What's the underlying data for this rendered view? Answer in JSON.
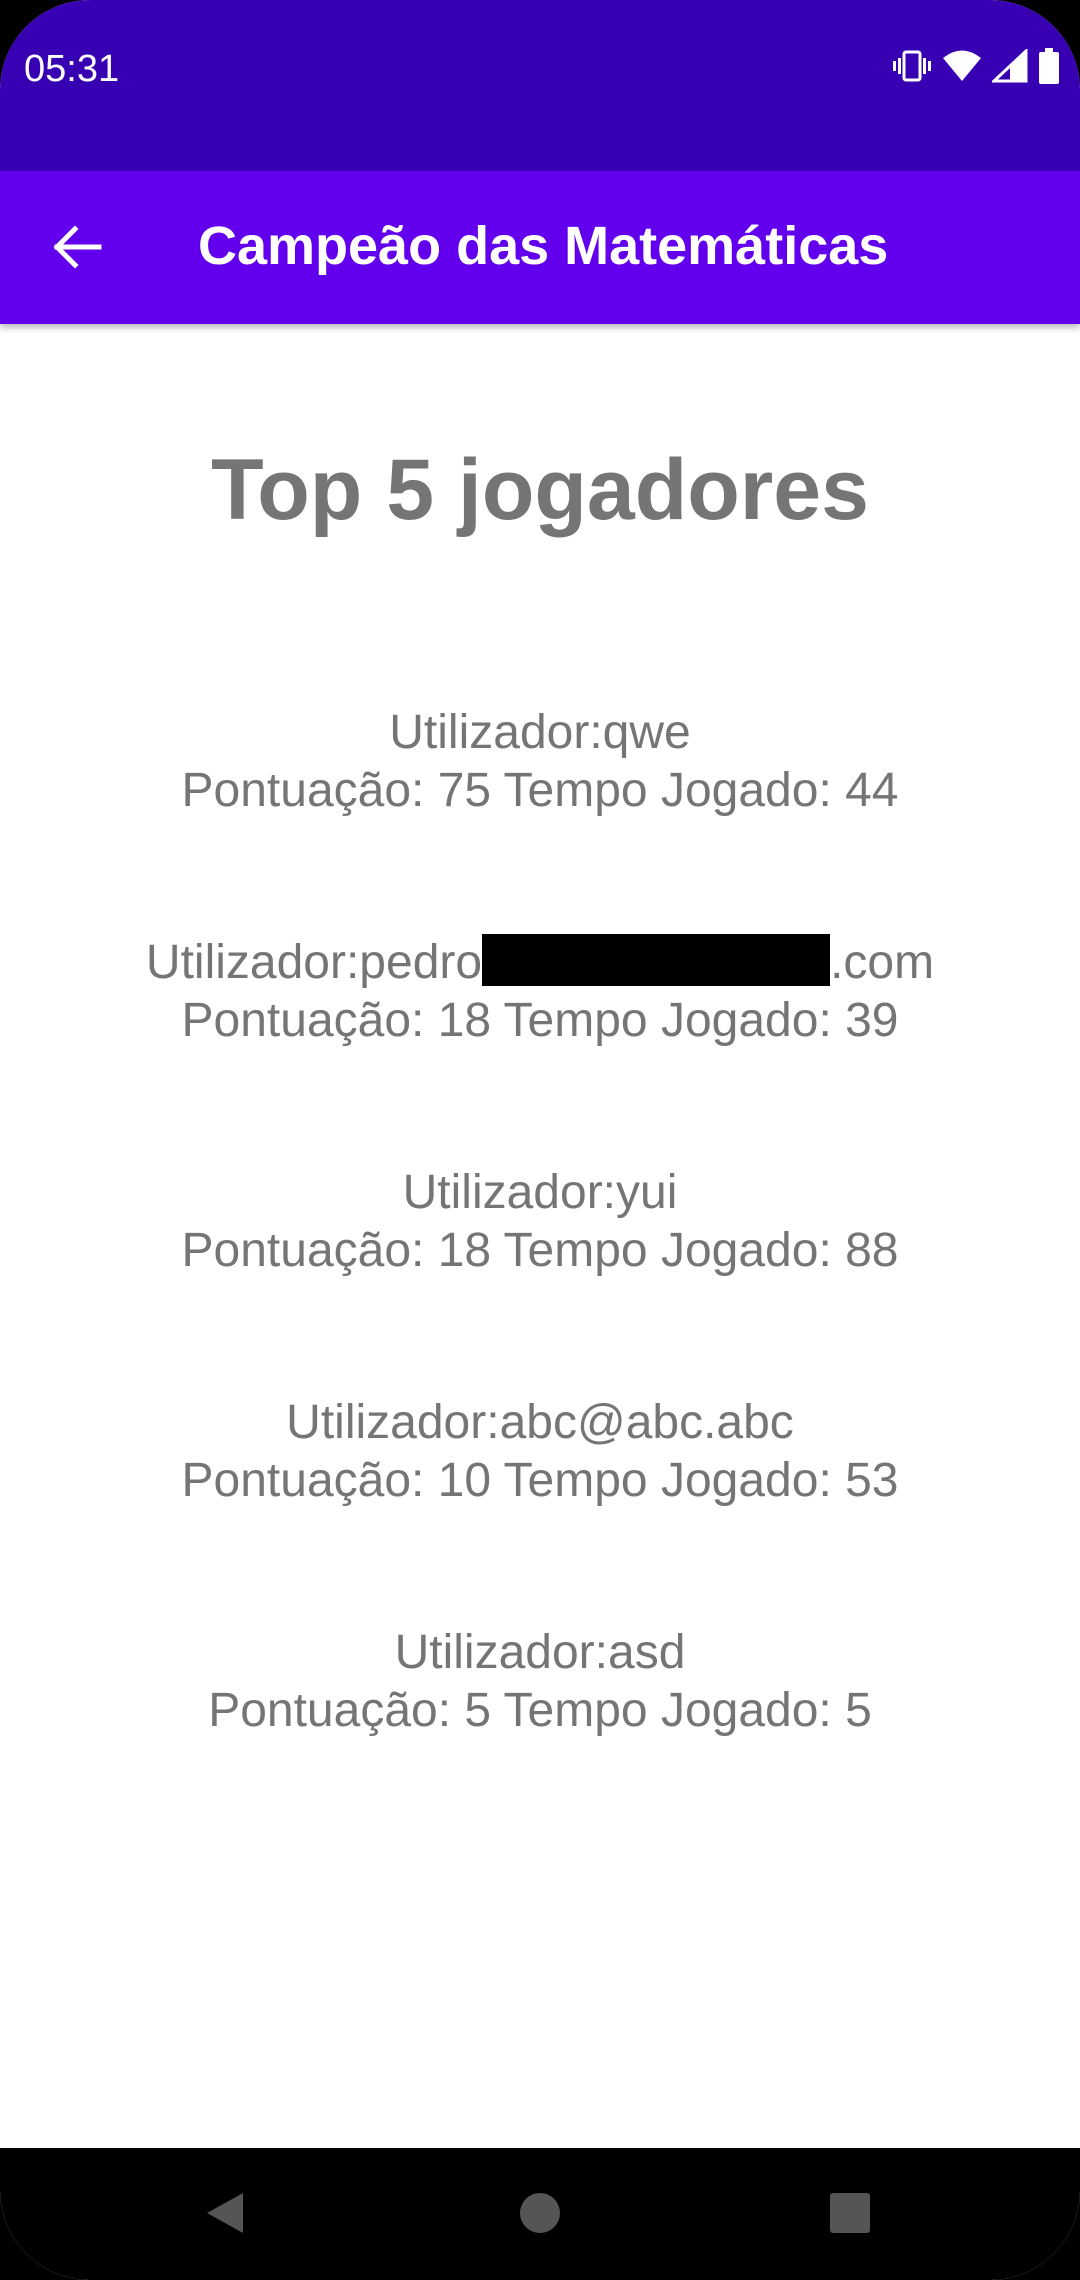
{
  "status_bar": {
    "time": "05:31",
    "icons": [
      "vibrate-icon",
      "wifi-icon",
      "signal-icon",
      "battery-icon"
    ]
  },
  "app_bar": {
    "title": "Campeão das Matemáticas",
    "back_icon": "arrow-back-icon"
  },
  "main": {
    "heading": "Top 5 jogadores",
    "players": [
      {
        "user_line": "Utilizador:qwe",
        "score_line": "Pontuação: 75 Tempo Jogado: 44"
      },
      {
        "user_prefix": "Utilizador:pedro",
        "user_suffix": ".com",
        "score_line": "Pontuação: 18 Tempo Jogado: 39"
      },
      {
        "user_line": "Utilizador:yui",
        "score_line": "Pontuação: 18 Tempo Jogado: 88"
      },
      {
        "user_line": "Utilizador:abc@abc.abc",
        "score_line": "Pontuação: 10 Tempo Jogado: 53"
      },
      {
        "user_line": "Utilizador:asd",
        "score_line": "Pontuação: 5 Tempo Jogado: 5"
      }
    ]
  },
  "nav_bar": {
    "icons": [
      "nav-back-icon",
      "nav-home-icon",
      "nav-recents-icon"
    ]
  },
  "colors": {
    "status_bar": "#3700b3",
    "app_bar": "#6200ee",
    "text_gray": "#757575"
  }
}
